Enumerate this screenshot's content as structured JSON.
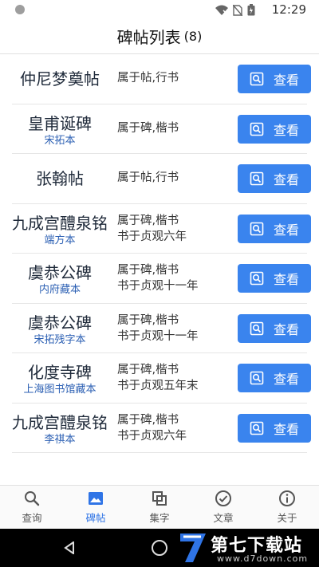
{
  "status_bar": {
    "time": "12:29"
  },
  "header": {
    "title": "碑帖列表",
    "count": "(8)"
  },
  "list": [
    {
      "name": "仲尼梦奠帖",
      "sub": "",
      "desc": [
        "属于帖,行书"
      ],
      "button": "查看"
    },
    {
      "name": "皇甫诞碑",
      "sub": "宋拓本",
      "desc": [
        "属于碑,楷书"
      ],
      "button": "查看"
    },
    {
      "name": "张翰帖",
      "sub": "",
      "desc": [
        "属于帖,行书"
      ],
      "button": "查看"
    },
    {
      "name": "九成宫醴泉铭",
      "sub": "端方本",
      "desc": [
        "属于碑,楷书",
        "书于贞观六年"
      ],
      "button": "查看"
    },
    {
      "name": "虞恭公碑",
      "sub": "内府藏本",
      "desc": [
        "属于碑,楷书",
        "书于贞观十一年"
      ],
      "button": "查看"
    },
    {
      "name": "虞恭公碑",
      "sub": "宋拓残字本",
      "desc": [
        "属于碑,楷书",
        "书于贞观十一年"
      ],
      "button": "查看"
    },
    {
      "name": "化度寺碑",
      "sub": "上海图书馆藏本",
      "desc": [
        "属于碑,楷书",
        "书于贞观五年末"
      ],
      "button": "查看"
    },
    {
      "name": "九成宫醴泉铭",
      "sub": "李祺本",
      "desc": [
        "属于碑,楷书",
        "书于贞观六年"
      ],
      "button": "查看"
    }
  ],
  "tabs": [
    {
      "label": "查询",
      "icon": "search-icon",
      "active": false
    },
    {
      "label": "碑帖",
      "icon": "image-icon",
      "active": true
    },
    {
      "label": "集字",
      "icon": "copy-icon",
      "active": false
    },
    {
      "label": "文章",
      "icon": "check-circle-icon",
      "active": false
    },
    {
      "label": "关于",
      "icon": "info-icon",
      "active": false
    }
  ],
  "watermark": {
    "main": "第七下载站",
    "url": "www.d7down.com"
  },
  "colors": {
    "accent": "#3a84ee",
    "sub_text": "#2b5fb3",
    "active_tab": "#2f74e6"
  }
}
